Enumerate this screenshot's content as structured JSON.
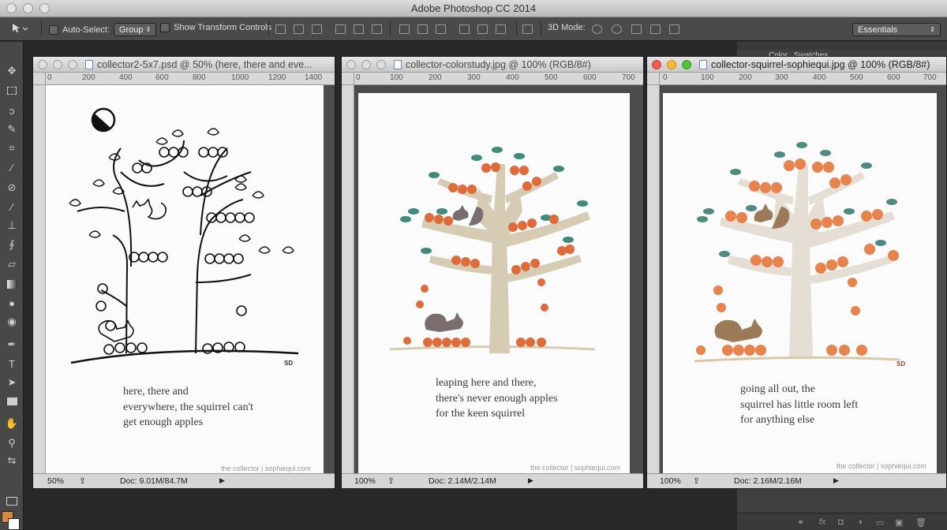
{
  "app": {
    "title": "Adobe Photoshop CC 2014"
  },
  "options_bar": {
    "auto_select_label": "Auto-Select:",
    "auto_select_value": "Group",
    "show_transform_label": "Show Transform Controls",
    "mode_3d_label": "3D Mode:",
    "workspace_value": "Essentials"
  },
  "right_panel": {
    "tabs": [
      "Color",
      "Swatches"
    ]
  },
  "colors": {
    "foreground": "#d88a3a",
    "background": "#ffffff",
    "active_close": "#f45b52",
    "active_minimize": "#f7bb2f",
    "active_zoom": "#4fc33e",
    "apple": "#e06b3a",
    "leaf": "#3f8c7d",
    "trunk": "#d6ccb3",
    "squirrel_gray": "#7a6d6d",
    "squirrel_brown": "#9b7a5a"
  },
  "documents": [
    {
      "title": "collector2-5x7.psd @ 50% (here, there and  eve...",
      "ruler_ticks": [
        "0",
        "200",
        "400",
        "600",
        "800",
        "1000",
        "1200",
        "1400"
      ],
      "zoom": "50%",
      "doc_size": "Doc: 9.01M/84.7M",
      "signature": "SD",
      "poem": [
        "here, there and",
        "everywhere, the squirrel can't",
        "get enough apples"
      ],
      "credit": "the collector | sophiequi.com"
    },
    {
      "title": "collector-colorstudy.jpg @ 100% (RGB/8#)",
      "ruler_ticks": [
        "0",
        "100",
        "200",
        "300",
        "400",
        "500",
        "600",
        "700"
      ],
      "zoom": "100%",
      "doc_size": "Doc: 2.14M/2.14M",
      "poem": [
        "leaping here and there,",
        "there's never enough apples",
        "for the keen squirrel"
      ],
      "credit": "the collector | sophiequi.com"
    },
    {
      "title": "collector-squirrel-sophiequi.jpg @ 100% (RGB/8#)",
      "ruler_ticks": [
        "0",
        "100",
        "200",
        "300",
        "400",
        "500",
        "600",
        "700"
      ],
      "zoom": "100%",
      "doc_size": "Doc: 2.16M/2.16M",
      "signature": "SD",
      "poem": [
        "going all out, the",
        "squirrel has little room left",
        "for anything else"
      ],
      "credit": "the collector | sophiequi.com"
    }
  ]
}
